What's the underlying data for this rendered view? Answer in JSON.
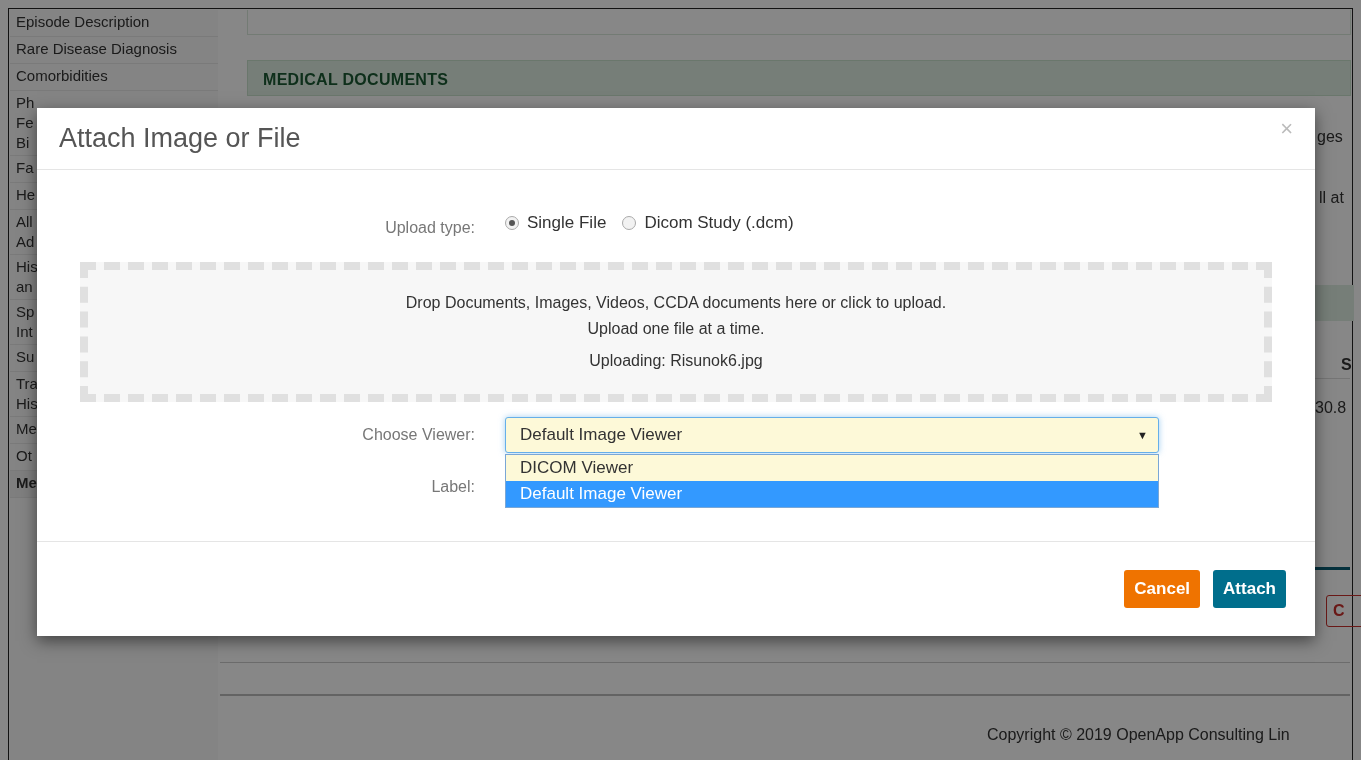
{
  "sidebar": {
    "items": [
      {
        "label": "Episode Description",
        "selected": false
      },
      {
        "label": "Rare Disease Diagnosis",
        "selected": false
      },
      {
        "label": "Comorbidities",
        "selected": false
      },
      {
        "label": "Ph Fe Bi",
        "selected": false
      },
      {
        "label": "Fa",
        "selected": false
      },
      {
        "label": "He",
        "selected": false
      },
      {
        "label": "All Ad",
        "selected": false
      },
      {
        "label": "His an",
        "selected": false
      },
      {
        "label": "Sp Int",
        "selected": false
      },
      {
        "label": "Su",
        "selected": false
      },
      {
        "label": "Tra His",
        "selected": false
      },
      {
        "label": "Me",
        "selected": false
      },
      {
        "label": "Ot",
        "selected": false
      },
      {
        "label": "Me",
        "selected": true
      }
    ]
  },
  "main": {
    "section_title": "MEDICAL DOCUMENTS",
    "text_1": "ges",
    "text_2": "ll at",
    "column_heading": "S",
    "cell": "30.8",
    "button": "C"
  },
  "footer": {
    "copyright": "Copyright © 2019 OpenApp Consulting Lin"
  },
  "modal": {
    "title": "Attach Image or File",
    "close": "×",
    "upload_type": {
      "label": "Upload type:",
      "options": [
        {
          "label": "Single File",
          "selected": true
        },
        {
          "label": "Dicom Study (.dcm)",
          "selected": false
        }
      ]
    },
    "dropzone": {
      "lines": [
        "Drop Documents, Images, Videos, CCDA documents here or click to upload.",
        "Upload one file at a time.",
        "Uploading: Risunok6.jpg"
      ]
    },
    "viewer": {
      "label": "Choose Viewer:",
      "value": "Default Image Viewer",
      "caret": "▼",
      "expanded": true,
      "options": [
        {
          "label": "DICOM Viewer",
          "selected": false
        },
        {
          "label": "Default Image Viewer",
          "selected": true
        }
      ]
    },
    "label_field": {
      "label": "Label:"
    },
    "buttons": [
      {
        "label": "Cancel",
        "kind": "cancel"
      },
      {
        "label": "Attach",
        "kind": "primary"
      }
    ]
  }
}
